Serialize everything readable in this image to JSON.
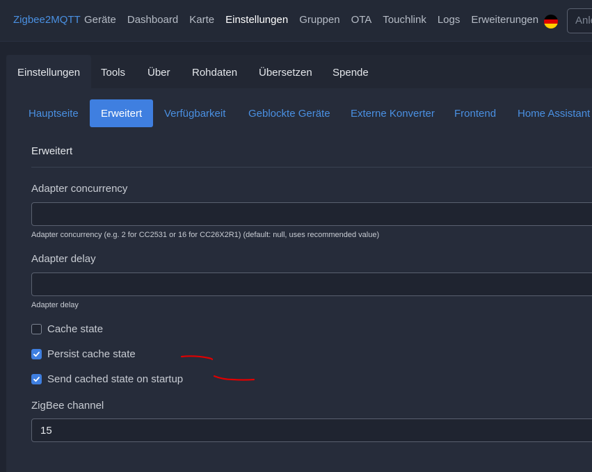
{
  "navbar": {
    "brand": "Zigbee2MQTT",
    "links": [
      {
        "label": "Geräte",
        "active": false
      },
      {
        "label": "Dashboard",
        "active": false
      },
      {
        "label": "Karte",
        "active": false
      },
      {
        "label": "Einstellungen",
        "active": true
      },
      {
        "label": "Gruppen",
        "active": false
      },
      {
        "label": "OTA",
        "active": false
      },
      {
        "label": "Touchlink",
        "active": false
      },
      {
        "label": "Logs",
        "active": false
      },
      {
        "label": "Erweiterungen",
        "active": false
      }
    ],
    "language_icon": "german-flag-icon",
    "search_placeholder": "Anleitung"
  },
  "card_tabs": [
    {
      "label": "Einstellungen",
      "active": true
    },
    {
      "label": "Tools",
      "active": false
    },
    {
      "label": "Über",
      "active": false
    },
    {
      "label": "Rohdaten",
      "active": false
    },
    {
      "label": "Übersetzen",
      "active": false
    },
    {
      "label": "Spende",
      "active": false
    }
  ],
  "pills": [
    {
      "label": "Hauptseite",
      "active": false
    },
    {
      "label": "Erweitert",
      "active": true
    },
    {
      "label": "Verfügbarkeit",
      "active": false
    },
    {
      "label": "Geblockte Geräte",
      "active": false
    },
    {
      "label": "Externe Konverter",
      "active": false
    },
    {
      "label": "Frontend",
      "active": false
    },
    {
      "label": "Home Assistant",
      "active": false
    }
  ],
  "form": {
    "section_title": "Erweitert",
    "adapter_concurrency": {
      "label": "Adapter concurrency",
      "value": "",
      "help": "Adapter concurrency (e.g. 2 for CC2531 or 16 for CC26X2R1) (default: null, uses recommended value)"
    },
    "adapter_delay": {
      "label": "Adapter delay",
      "value": "",
      "help": "Adapter delay"
    },
    "checkboxes": [
      {
        "label": "Cache state",
        "checked": false
      },
      {
        "label": "Persist cache state",
        "checked": true
      },
      {
        "label": "Send cached state on startup",
        "checked": true
      }
    ],
    "zigbee_channel": {
      "label": "ZigBee channel",
      "value": "15"
    }
  },
  "colors": {
    "accent": "#3f7fe0",
    "link": "#4a90e2",
    "annotation": "#e00000"
  }
}
